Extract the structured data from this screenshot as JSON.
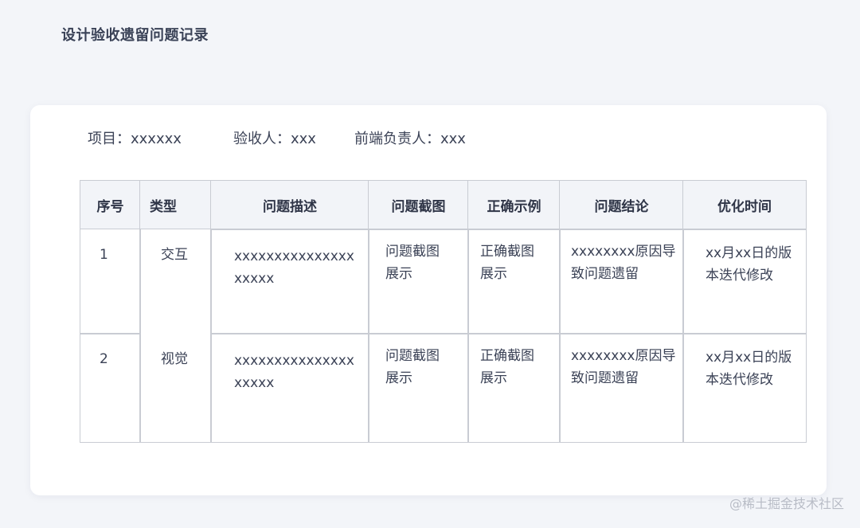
{
  "page": {
    "title": "设计验收遗留问题记录"
  },
  "meta": {
    "project": "项目：xxxxxx",
    "reviewer": "验收人：xxx",
    "frontend_owner": "前端负责人：xxx"
  },
  "table": {
    "headers": [
      "序号",
      "类型",
      "问题描述",
      "问题截图",
      "正确示例",
      "问题结论",
      "优化时间"
    ],
    "rows": [
      {
        "index": "1",
        "type": "交互",
        "desc_line1": "xxxxxxxxxxxxxxx",
        "desc_line2": "xxxxx",
        "shot_line1": "问题截图",
        "shot_line2": "展示",
        "correct_line1": "正确截图",
        "correct_line2": "展示",
        "conclusion_line1": "xxxxxxxx原因导",
        "conclusion_line2": "致问题遗留",
        "time_line1": "xx月xx日的版",
        "time_line2": "本迭代修改"
      },
      {
        "index": "2",
        "type": "视觉",
        "desc_line1": "xxxxxxxxxxxxxxx",
        "desc_line2": "xxxxx",
        "shot_line1": "问题截图",
        "shot_line2": "展示",
        "correct_line1": "正确截图",
        "correct_line2": "展示",
        "conclusion_line1": "xxxxxxxx原因导",
        "conclusion_line2": "致问题遗留",
        "time_line1": "xx月xx日的版",
        "time_line2": "本迭代修改"
      }
    ]
  },
  "watermark": "@稀土掘金技术社区"
}
